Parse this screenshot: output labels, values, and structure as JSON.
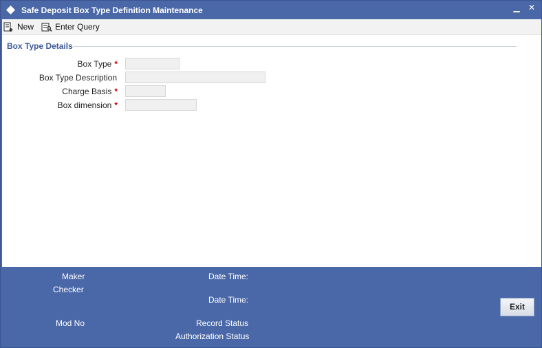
{
  "window": {
    "title": "Safe Deposit Box Type Definition Maintenance",
    "minimize": "▁",
    "close": "✕"
  },
  "toolbar": {
    "new_label": "New",
    "query_label": "Enter Query"
  },
  "section": {
    "title": "Box Type Details"
  },
  "fields": {
    "box_type": {
      "label": "Box Type",
      "required": "*",
      "value": ""
    },
    "box_type_desc": {
      "label": "Box Type Description",
      "value": ""
    },
    "charge_basis": {
      "label": "Charge Basis",
      "required": "*",
      "value": ""
    },
    "box_dimension": {
      "label": "Box dimension",
      "required": "*",
      "value": ""
    }
  },
  "footer": {
    "maker": "Maker",
    "checker": "Checker",
    "mod_no": "Mod No",
    "date_time_1": "Date Time:",
    "date_time_2": "Date Time:",
    "record_status": "Record Status",
    "auth_status": "Authorization Status",
    "exit_label": "Exit"
  },
  "colors": {
    "frame": "#4a68a8",
    "section_title": "#3c5a9a",
    "required": "#cc0000"
  }
}
